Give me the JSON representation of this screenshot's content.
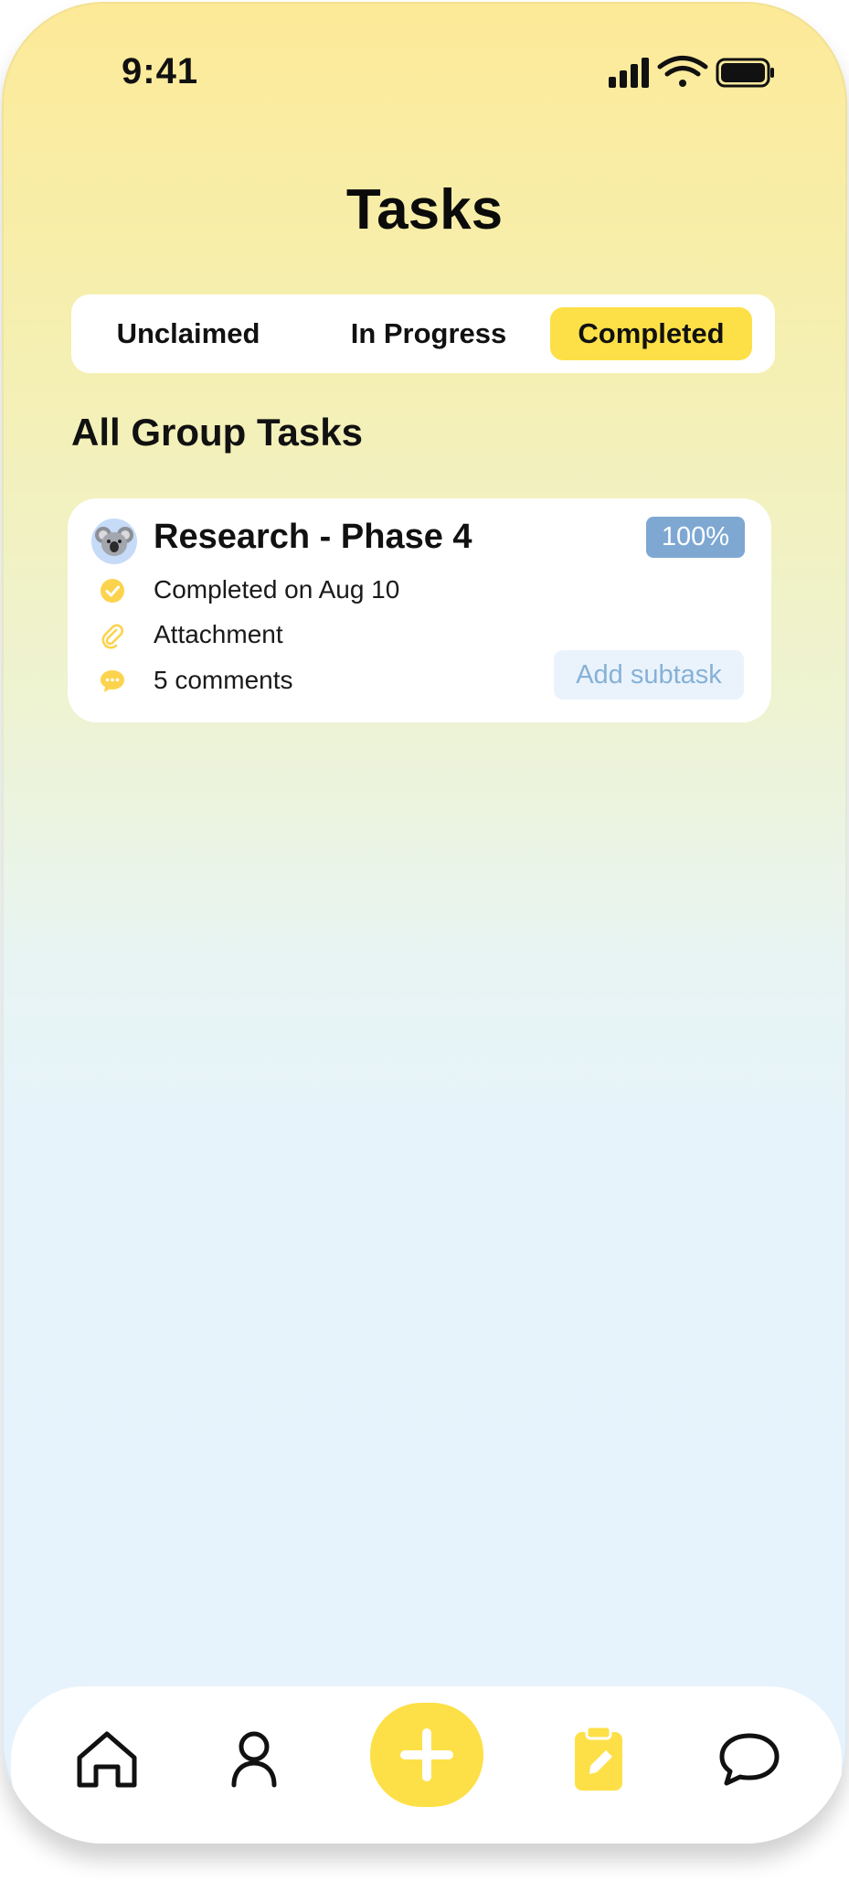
{
  "status_bar": {
    "time": "9:41",
    "icons": [
      "cellular-signal-icon",
      "wifi-icon",
      "battery-icon"
    ]
  },
  "header": {
    "title": "Tasks"
  },
  "tabs": [
    {
      "label": "Unclaimed",
      "selected": false
    },
    {
      "label": "In Progress",
      "selected": false
    },
    {
      "label": "Completed",
      "selected": true
    }
  ],
  "section": {
    "title": "All Group Tasks"
  },
  "task": {
    "avatar": "koala-avatar",
    "title": "Research - Phase 4",
    "progress_label": "100%",
    "progress": 1.0,
    "completed_text": "Completed on Aug 10",
    "attachment_text": "Attachment",
    "comments_text": "5 comments",
    "add_subtask_label": "Add subtask"
  },
  "bottom_nav": {
    "items": [
      "home-icon",
      "profile-icon",
      "add-icon",
      "tasks-clipboard-icon",
      "chat-icon"
    ],
    "active": "tasks-clipboard-icon"
  },
  "colors": {
    "accent": "#fde047",
    "badge": "#7ea8d2",
    "add_subtask_bg": "#eaf3fc",
    "add_subtask_text": "#86b1d6"
  }
}
